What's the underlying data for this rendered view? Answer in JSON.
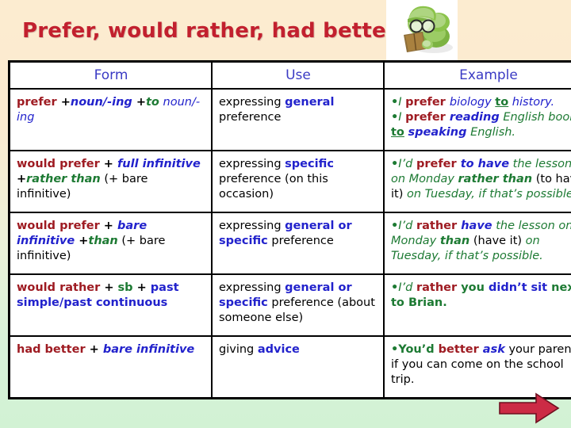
{
  "slide": {
    "title": "Prefer, would rather, had better",
    "title_color": "#c2202e",
    "background_top_color": "#fcecd0",
    "background_bottom_color": "#d2f2d4",
    "clipart": "bookworm-reading-icon",
    "next_arrow": "right-arrow-icon",
    "next_arrow_color": "#cc2b45"
  },
  "table": {
    "headers": [
      "Form",
      "Use",
      "Example"
    ],
    "header_color": "#3b3bc4",
    "rows": [
      {
        "form_plain": "prefer +noun/-ing +to noun/-ing",
        "form_tokens": [
          {
            "text": "prefer",
            "color": "red",
            "style": "bold"
          },
          {
            "text": " +",
            "color": "black",
            "style": "bold"
          },
          {
            "text": "noun/-ing",
            "color": "blue",
            "style": "bold-italic"
          },
          {
            "text": " +",
            "color": "black",
            "style": "bold"
          },
          {
            "text": "to",
            "color": "green",
            "style": "bold-italic"
          },
          {
            "text": " ",
            "color": "black",
            "style": "plain"
          },
          {
            "text": "noun/-ing",
            "color": "blue",
            "style": "italic"
          }
        ],
        "use_plain": "expressing general preference",
        "use_tokens": [
          {
            "text": "expressing ",
            "color": "black",
            "style": "plain"
          },
          {
            "text": "general",
            "color": "blue",
            "style": "bold"
          },
          {
            "text": " preference",
            "color": "black",
            "style": "plain"
          }
        ],
        "example_plain": "• I prefer biology to history. • I prefer reading English books to speaking English.",
        "example_lines": [
          [
            {
              "text": "•",
              "color": "green",
              "style": "bold"
            },
            {
              "text": "I ",
              "color": "green",
              "style": "italic"
            },
            {
              "text": "prefer ",
              "color": "red",
              "style": "bold"
            },
            {
              "text": "biology ",
              "color": "blue",
              "style": "italic"
            },
            {
              "text": "to",
              "color": "green",
              "style": "bold-underline"
            },
            {
              "text": " history.",
              "color": "blue",
              "style": "italic"
            }
          ],
          [
            {
              "text": "•",
              "color": "green",
              "style": "bold"
            },
            {
              "text": "I ",
              "color": "green",
              "style": "italic"
            },
            {
              "text": "prefer ",
              "color": "red",
              "style": "bold"
            },
            {
              "text": "reading",
              "color": "blue",
              "style": "bold-italic"
            },
            {
              "text": " English books ",
              "color": "green",
              "style": "italic"
            },
            {
              "text": "to",
              "color": "green",
              "style": "bold-underline"
            },
            {
              "text": " ",
              "color": "green",
              "style": "plain"
            },
            {
              "text": "speaking",
              "color": "blue",
              "style": "bold-italic"
            },
            {
              "text": " English.",
              "color": "green",
              "style": "italic"
            }
          ]
        ]
      },
      {
        "form_plain": "would prefer + full infinitive +rather than (+ bare infinitive)",
        "form_tokens": [
          {
            "text": "would prefer",
            "color": "red",
            "style": "bold"
          },
          {
            "text": " + ",
            "color": "black",
            "style": "bold"
          },
          {
            "text": "full infinitive",
            "color": "blue",
            "style": "bold-italic"
          },
          {
            "text": "  +",
            "color": "black",
            "style": "bold"
          },
          {
            "text": "rather than",
            "color": "green",
            "style": "bold-italic"
          },
          {
            "text": " (+ bare infinitive)",
            "color": "black",
            "style": "plain"
          }
        ],
        "use_plain": "expressing specific preference (on this occasion)",
        "use_tokens": [
          {
            "text": "expressing ",
            "color": "black",
            "style": "plain"
          },
          {
            "text": "specific",
            "color": "blue",
            "style": "bold"
          },
          {
            "text": " preference (on this occasion)",
            "color": "black",
            "style": "plain"
          }
        ],
        "example_plain": "• I'd prefer to have the lesson on Monday rather than (to have it) on Tuesday, if that's possible.",
        "example_lines": [
          [
            {
              "text": "•",
              "color": "green",
              "style": "bold"
            },
            {
              "text": "I’d ",
              "color": "green",
              "style": "italic"
            },
            {
              "text": "prefer ",
              "color": "red",
              "style": "bold"
            },
            {
              "text": "to have",
              "color": "blue",
              "style": "bold-italic"
            },
            {
              "text": " the lesson on Monday ",
              "color": "green",
              "style": "italic"
            },
            {
              "text": "rather than",
              "color": "green",
              "style": "bold-italic"
            },
            {
              "text": " (to have it)",
              "color": "black",
              "style": "plain"
            },
            {
              "text": " on Tuesday, if that’s possible.",
              "color": "green",
              "style": "italic"
            }
          ]
        ]
      },
      {
        "form_plain": "would prefer + bare infinitive +than (+ bare infinitive)",
        "form_tokens": [
          {
            "text": "would prefer",
            "color": "red",
            "style": "bold"
          },
          {
            "text": " + ",
            "color": "black",
            "style": "bold"
          },
          {
            "text": "bare infinitive",
            "color": "blue",
            "style": "bold-italic"
          },
          {
            "text": "  +",
            "color": "black",
            "style": "bold"
          },
          {
            "text": "than",
            "color": "green",
            "style": "bold-italic"
          },
          {
            "text": " (+ bare infinitive)",
            "color": "black",
            "style": "plain"
          }
        ],
        "use_plain": "expressing general or specific preference",
        "use_tokens": [
          {
            "text": "expressing ",
            "color": "black",
            "style": "plain"
          },
          {
            "text": "general or specific",
            "color": "blue",
            "style": "bold"
          },
          {
            "text": " preference",
            "color": "black",
            "style": "plain"
          }
        ],
        "example_plain": "• I'd rather have the lesson on Monday than (have it) on Tuesday, if that's possible.",
        "example_lines": [
          [
            {
              "text": "•",
              "color": "green",
              "style": "bold"
            },
            {
              "text": "I’d ",
              "color": "green",
              "style": "italic"
            },
            {
              "text": "rather ",
              "color": "red",
              "style": "bold"
            },
            {
              "text": "have",
              "color": "blue",
              "style": "bold-italic"
            },
            {
              "text": " the lesson on Monday  ",
              "color": "green",
              "style": "italic"
            },
            {
              "text": "than",
              "color": "green",
              "style": "bold-italic"
            },
            {
              "text": " (have it)",
              "color": "black",
              "style": "plain"
            },
            {
              "text": " on Tuesday, if that’s possible.",
              "color": "green",
              "style": "italic"
            }
          ]
        ]
      },
      {
        "form_plain": "would rather + sb + past simple/past continuous",
        "form_tokens": [
          {
            "text": "would rather",
            "color": "red",
            "style": "bold"
          },
          {
            "text": " + ",
            "color": "black",
            "style": "bold"
          },
          {
            "text": "sb",
            "color": "green",
            "style": "bold"
          },
          {
            "text": " + ",
            "color": "black",
            "style": "bold"
          },
          {
            "text": "past simple/past continuous",
            "color": "blue",
            "style": "bold"
          }
        ],
        "use_plain": "expressing general or specific preference (about someone else)",
        "use_tokens": [
          {
            "text": "expressing ",
            "color": "black",
            "style": "plain"
          },
          {
            "text": "general or specific",
            "color": "blue",
            "style": "bold"
          },
          {
            "text": " preference (about someone else)",
            "color": "black",
            "style": "plain"
          }
        ],
        "example_plain": "• I'd rather you didn't sit next to Brian.",
        "example_lines": [
          [
            {
              "text": "•",
              "color": "green",
              "style": "bold"
            },
            {
              "text": "I’d ",
              "color": "green",
              "style": "italic"
            },
            {
              "text": "rather ",
              "color": "red",
              "style": "bold"
            },
            {
              "text": "you ",
              "color": "green",
              "style": "bold"
            },
            {
              "text": "didn’t sit",
              "color": "blue",
              "style": "bold"
            },
            {
              "text": " next to Brian.",
              "color": "green",
              "style": "bold"
            }
          ]
        ]
      },
      {
        "form_plain": "had better + bare infinitive",
        "form_tokens": [
          {
            "text": "had better",
            "color": "red",
            "style": "bold"
          },
          {
            "text": " + ",
            "color": "black",
            "style": "bold"
          },
          {
            "text": "bare infinitive",
            "color": "blue",
            "style": "bold-italic"
          }
        ],
        "use_plain": "giving advice",
        "use_tokens": [
          {
            "text": "giving ",
            "color": "black",
            "style": "plain"
          },
          {
            "text": "advice",
            "color": "blue",
            "style": "bold"
          }
        ],
        "example_plain": "• You'd better ask your parents if you can come on the school trip.",
        "example_lines": [
          [
            {
              "text": "•",
              "color": "green",
              "style": "bold"
            },
            {
              "text": "You’d ",
              "color": "green",
              "style": "bold"
            },
            {
              "text": "better ",
              "color": "red",
              "style": "bold"
            },
            {
              "text": "ask",
              "color": "blue",
              "style": "bold-italic"
            },
            {
              "text": " your parents if you can come on the school trip.",
              "color": "black",
              "style": "plain"
            }
          ]
        ]
      }
    ]
  }
}
